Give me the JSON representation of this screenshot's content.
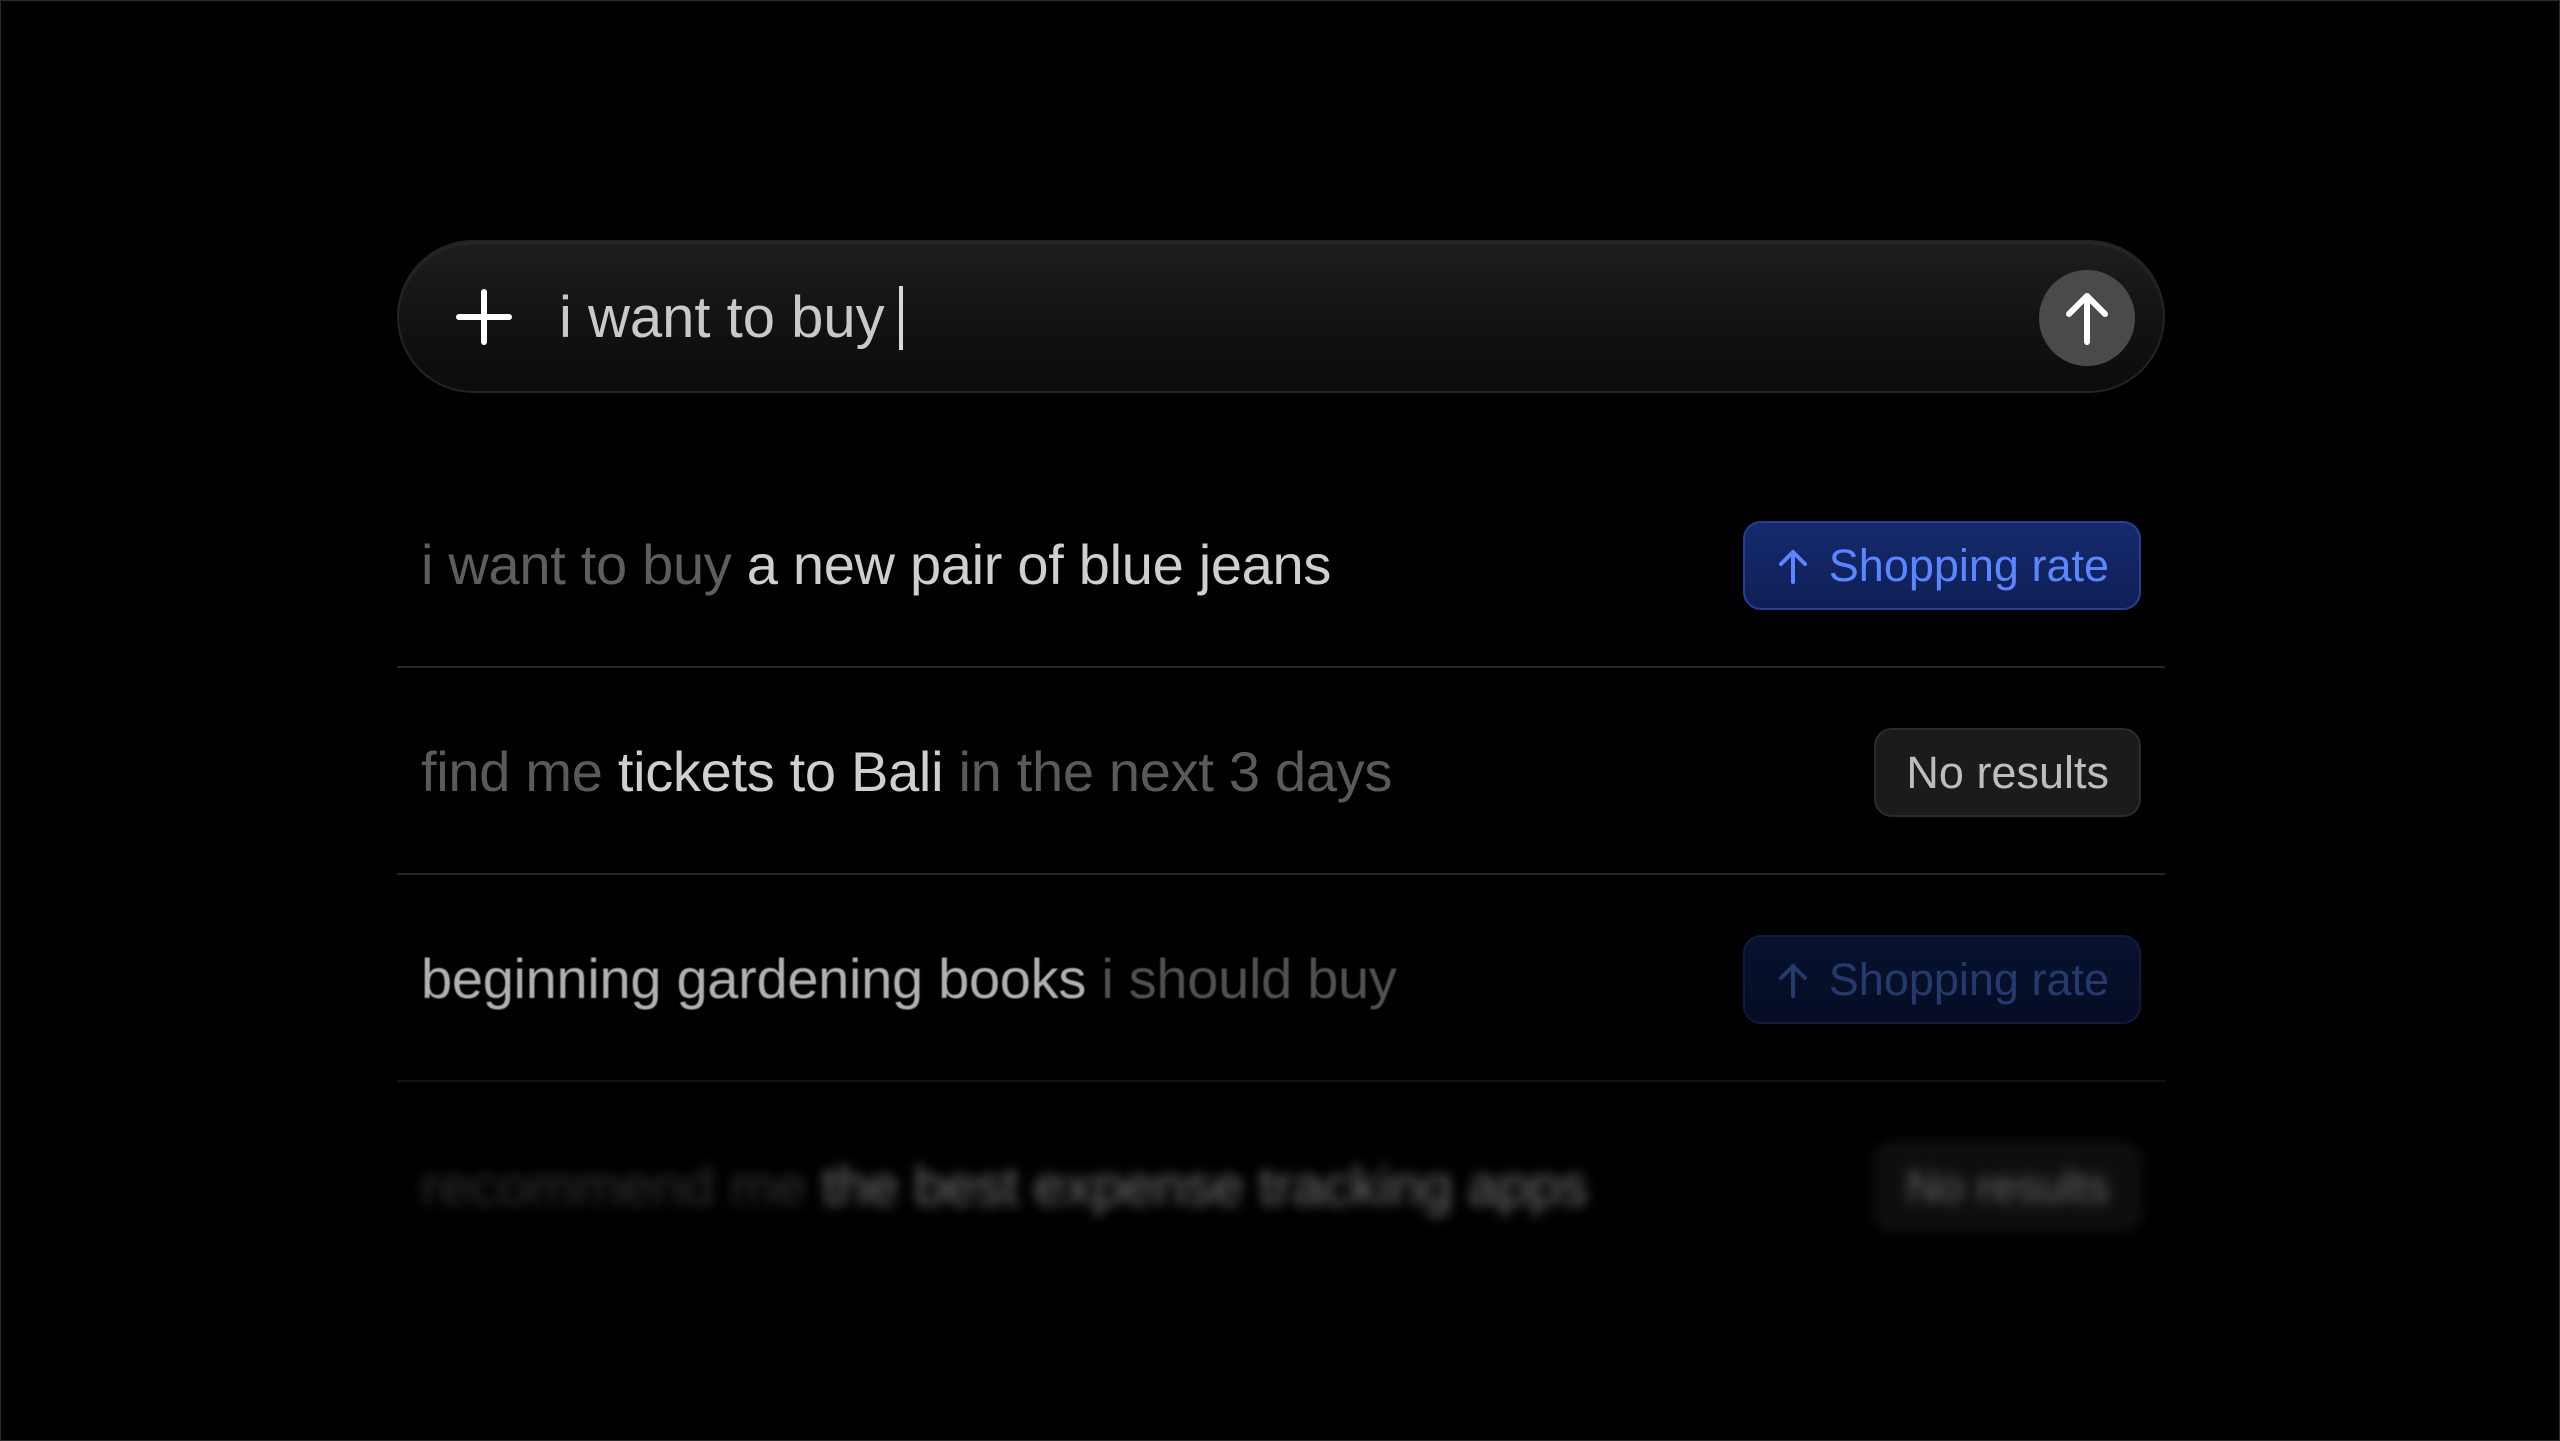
{
  "search": {
    "value": "i want to buy",
    "plus_icon": "plus-icon",
    "send_icon": "arrow-up-icon"
  },
  "suggestions": [
    {
      "parts": [
        "i want to buy",
        "a new pair of blue jeans"
      ],
      "badge": "Shopping rate",
      "badge_type": "shopping",
      "badge_icon": "arrow-up-icon"
    },
    {
      "parts": [
        "find me",
        "tickets to Bali",
        "in the next 3 days"
      ],
      "badge": "No results",
      "badge_type": "none"
    },
    {
      "parts": [
        "beginning gardening books",
        "i should buy"
      ],
      "badge": "Shopping rate",
      "badge_type": "shopping",
      "badge_icon": "arrow-up-icon"
    },
    {
      "parts": [
        "recommend me",
        "the best expense tracking apps"
      ],
      "badge": "No results",
      "badge_type": "none"
    }
  ],
  "colors": {
    "background": "#000000",
    "accent_blue": "#5b86ff",
    "badge_blue_bg": "#152a6e",
    "dim_text": "#5e5e5e",
    "bright_text": "#cfcfcf"
  }
}
